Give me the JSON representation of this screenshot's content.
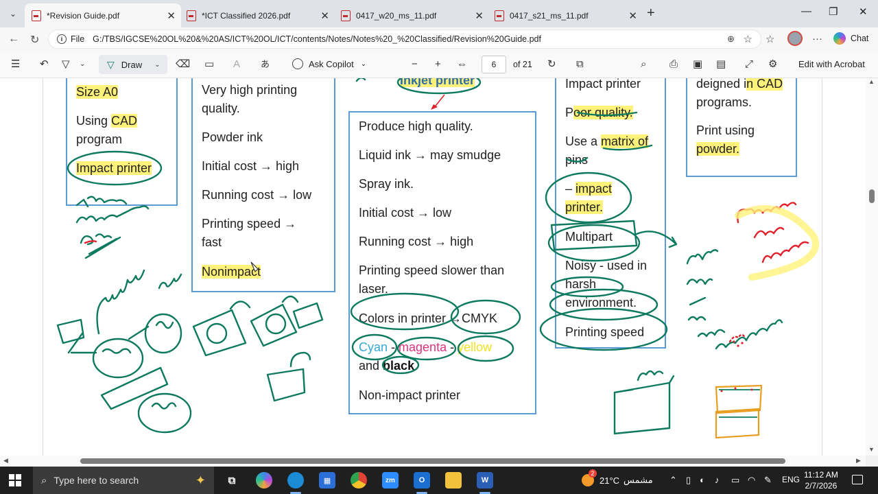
{
  "browser": {
    "tabs": [
      {
        "title": "*Revision Guide.pdf",
        "active": true
      },
      {
        "title": "*ICT Classified 2026.pdf",
        "active": false
      },
      {
        "title": "0417_w20_ms_11.pdf",
        "active": false
      },
      {
        "title": "0417_s21_ms_11.pdf",
        "active": false
      }
    ],
    "address": {
      "scheme_label": "File",
      "url": "G:/TBS/IGCSE%20OL%20&%20AS/ICT%20OL/ICT/contents/Notes/Notes%20_%20Classified/Revision%20Guide.pdf"
    },
    "chat_label": "Chat"
  },
  "pdf_toolbar": {
    "draw_label": "Draw",
    "ask_copilot_label": "Ask Copilot",
    "page_number": "6",
    "page_total": "of 21",
    "edit_acrobat_label": "Edit with Acrobat"
  },
  "document": {
    "col1": {
      "line1": "Size A0",
      "line2a": "Using ",
      "line2b": "CAD",
      "line3": "program",
      "line4": "Impact printer"
    },
    "col2": {
      "l1": "Very high printing",
      "l2": "quality.",
      "l3": "Powder ink",
      "l4": "Initial cost → high",
      "l5": "Running cost → low",
      "l6": "Printing speed →",
      "l7": "fast",
      "l8": "Nonimpact"
    },
    "col3": {
      "title": "Inkjet printer",
      "l1": "Produce high quality.",
      "l2": "Liquid ink → may smudge",
      "l3": "Spray ink.",
      "l4": "Initial cost → low",
      "l5": "Running cost → high",
      "l6": "Printing speed slower than",
      "l7": "laser.",
      "l8": "Colors in printer →CMYK",
      "cyan": "Cyan",
      "dash": " - ",
      "magenta": "magenta",
      "yellow": "yellow",
      "and": "and ",
      "black": "black",
      "l10": "Non-impact printer"
    },
    "col4": {
      "l1": "Impact printer",
      "l2a": "P",
      "l2b": "oor quality.",
      "l3a": "Use a ",
      "l3b": "matrix of",
      "l4": "pins",
      "l5a": "– ",
      "l5b": "impact",
      "l6": "printer.",
      "l7": "Multipart",
      "l8": "Noisy - used in",
      "l9": "harsh",
      "l10": "environment.",
      "l11": "Printing speed"
    },
    "col5": {
      "l1a": "deigned i",
      "l1b": "n CAD",
      "l2": "programs.",
      "l3": "Print using",
      "l4": "powder."
    }
  },
  "taskbar": {
    "search_placeholder": "Type here to search",
    "weather_temp": "21°C",
    "weather_text": "مشمس",
    "weather_badge": "2",
    "lang": "ENG",
    "time": "11:12 AM",
    "date": "2/7/2026"
  }
}
